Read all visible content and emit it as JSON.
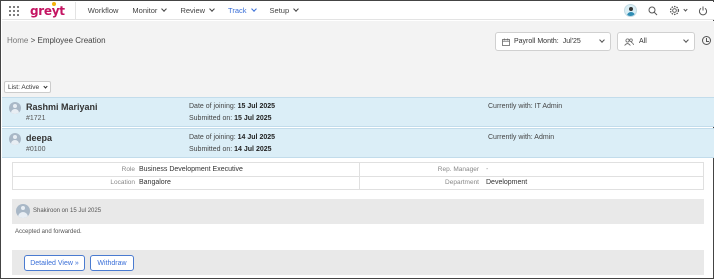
{
  "nav": {
    "logo": "greyt",
    "items": [
      {
        "label": "Workflow",
        "has_menu": false,
        "active": false
      },
      {
        "label": "Monitor",
        "has_menu": true,
        "active": false
      },
      {
        "label": "Review",
        "has_menu": true,
        "active": false
      },
      {
        "label": "Track",
        "has_menu": true,
        "active": true
      },
      {
        "label": "Setup",
        "has_menu": true,
        "active": false
      }
    ],
    "accent_color": "#3a6fd8",
    "logo_color": "#c41462"
  },
  "breadcrumb": {
    "home": "Home",
    "separator": ">",
    "current": "Employee Creation"
  },
  "filters": {
    "payroll_label": "Payroll Month:",
    "payroll_value": "Jul'25",
    "group_value": "All",
    "list_filter": "List: Active"
  },
  "employees": [
    {
      "name": "Rashmi Mariyani",
      "id": "#1721",
      "join_label": "Date of joining:",
      "join_date": "15 Jul 2025",
      "submitted_label": "Submitted on:",
      "submitted_date": "15 Jul 2025",
      "currently_with": "Currently with: IT Admin"
    },
    {
      "name": "deepa",
      "id": "#0100",
      "join_label": "Date of joining:",
      "join_date": "14 Jul 2025",
      "submitted_label": "Submitted on:",
      "submitted_date": "14 Jul 2025",
      "currently_with": "Currently with: Admin"
    }
  ],
  "details": {
    "role_label": "Role",
    "role_value": "Business Development Executive",
    "rep_manager_label": "Rep. Manager",
    "rep_manager_value": "-",
    "location_label": "Location",
    "location_value": "Bangalore",
    "department_label": "Department",
    "department_value": "Development"
  },
  "comment": {
    "author_line": "Shakiroon on 15 Jul 2025",
    "message": "Accepted and forwarded."
  },
  "actions": {
    "detailed_view": "Detailed View »",
    "withdraw": "Withdraw"
  }
}
